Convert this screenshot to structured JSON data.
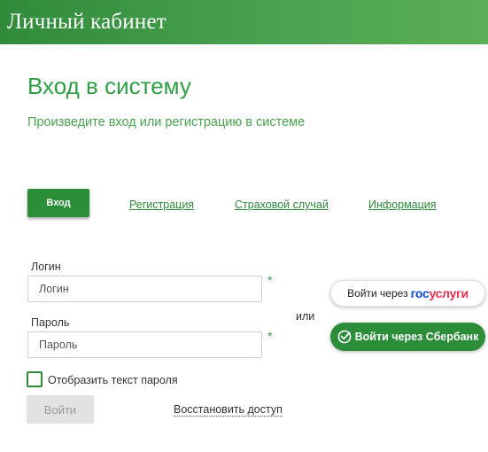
{
  "header": {
    "title": "Личный кабинет"
  },
  "page": {
    "title": "Вход в систему",
    "subtitle": "Произведите вход или регистрацию в системе"
  },
  "tabs": {
    "active": "Вход",
    "links": [
      "Регистрация",
      "Страховой случай",
      "Информация"
    ]
  },
  "form": {
    "login_label": "Логин",
    "login_placeholder": "Логин",
    "password_label": "Пароль",
    "password_placeholder": "Пароль",
    "required_mark": "*",
    "show_password_label": "Отобразить текст пароля",
    "submit_label": "Войти",
    "restore_label": "Восстановить доступ"
  },
  "alt_login": {
    "or_text": "или",
    "gosuslugi_prefix": "Войти через",
    "gosuslugi_logo_part1": "гос",
    "gosuslugi_logo_part2": "услуги",
    "sberbank_label": "Войти через Сбербанк"
  },
  "colors": {
    "brand_green": "#2f9e44",
    "header_green": "#3c9a45",
    "button_green": "#2b8f37",
    "gos_blue": "#0d4cd3",
    "gos_red": "#ee2f53"
  }
}
